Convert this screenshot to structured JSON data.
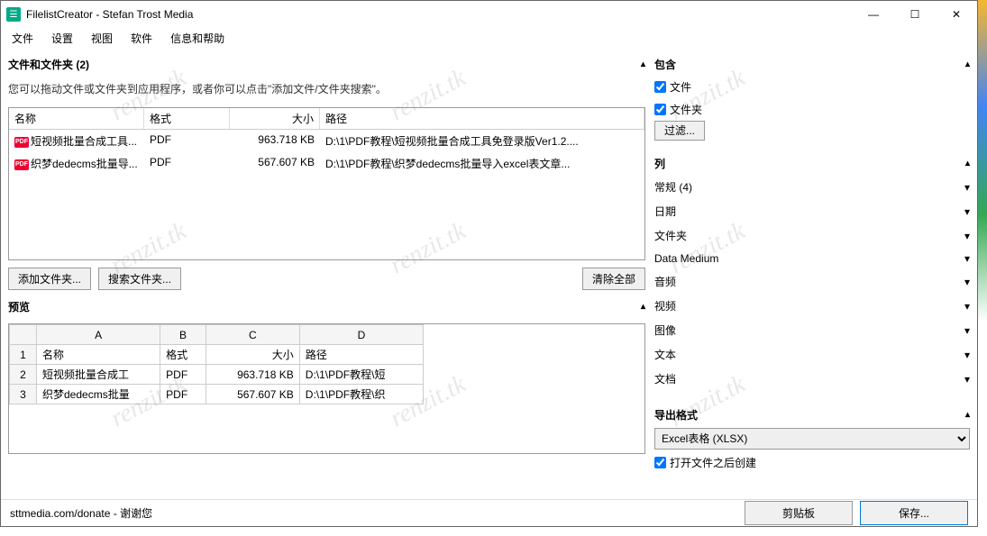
{
  "window": {
    "title": "FilelistCreator - Stefan Trost Media"
  },
  "menubar": [
    "文件",
    "设置",
    "视图",
    "软件",
    "信息和帮助"
  ],
  "files_section": {
    "title": "文件和文件夹 (2)",
    "hint": "您可以拖动文件或文件夹到应用程序，或者你可以点击\"添加文件/文件夹搜索\"。",
    "columns": {
      "name": "名称",
      "format": "格式",
      "size": "大小",
      "path": "路径"
    },
    "rows": [
      {
        "name": "短视频批量合成工具...",
        "format": "PDF",
        "size": "963.718 KB",
        "path": "D:\\1\\PDF教程\\短视频批量合成工具免登录版Ver1.2...."
      },
      {
        "name": "织梦dedecms批量导...",
        "format": "PDF",
        "size": "567.607 KB",
        "path": "D:\\1\\PDF教程\\织梦dedecms批量导入excel表文章..."
      }
    ],
    "buttons": {
      "add": "添加文件夹...",
      "search": "搜索文件夹...",
      "clear": "清除全部"
    }
  },
  "preview": {
    "title": "预览",
    "col_headers": [
      "A",
      "B",
      "C",
      "D"
    ],
    "rows": [
      [
        "1",
        "名称",
        "格式",
        "大小",
        "路径"
      ],
      [
        "2",
        "短视频批量合成工",
        "PDF",
        "963.718 KB",
        "D:\\1\\PDF教程\\短"
      ],
      [
        "3",
        "织梦dedecms批量",
        "PDF",
        "567.607 KB",
        "D:\\1\\PDF教程\\织"
      ]
    ]
  },
  "include": {
    "title": "包含",
    "file": "文件",
    "folder": "文件夹",
    "filter_btn": "过滤..."
  },
  "columns_section": {
    "title": "列",
    "items": [
      "常规 (4)",
      "日期",
      "文件夹",
      "Data Medium",
      "音频",
      "视频",
      "图像",
      "文本",
      "文档"
    ]
  },
  "export": {
    "title": "导出格式",
    "selected": "Excel表格 (XLSX)",
    "open_after": "打开文件之后创建"
  },
  "footer": {
    "donate": "sttmedia.com/donate - 谢谢您",
    "clipboard": "剪贴板",
    "save": "保存..."
  },
  "watermark": "renzit.tk"
}
